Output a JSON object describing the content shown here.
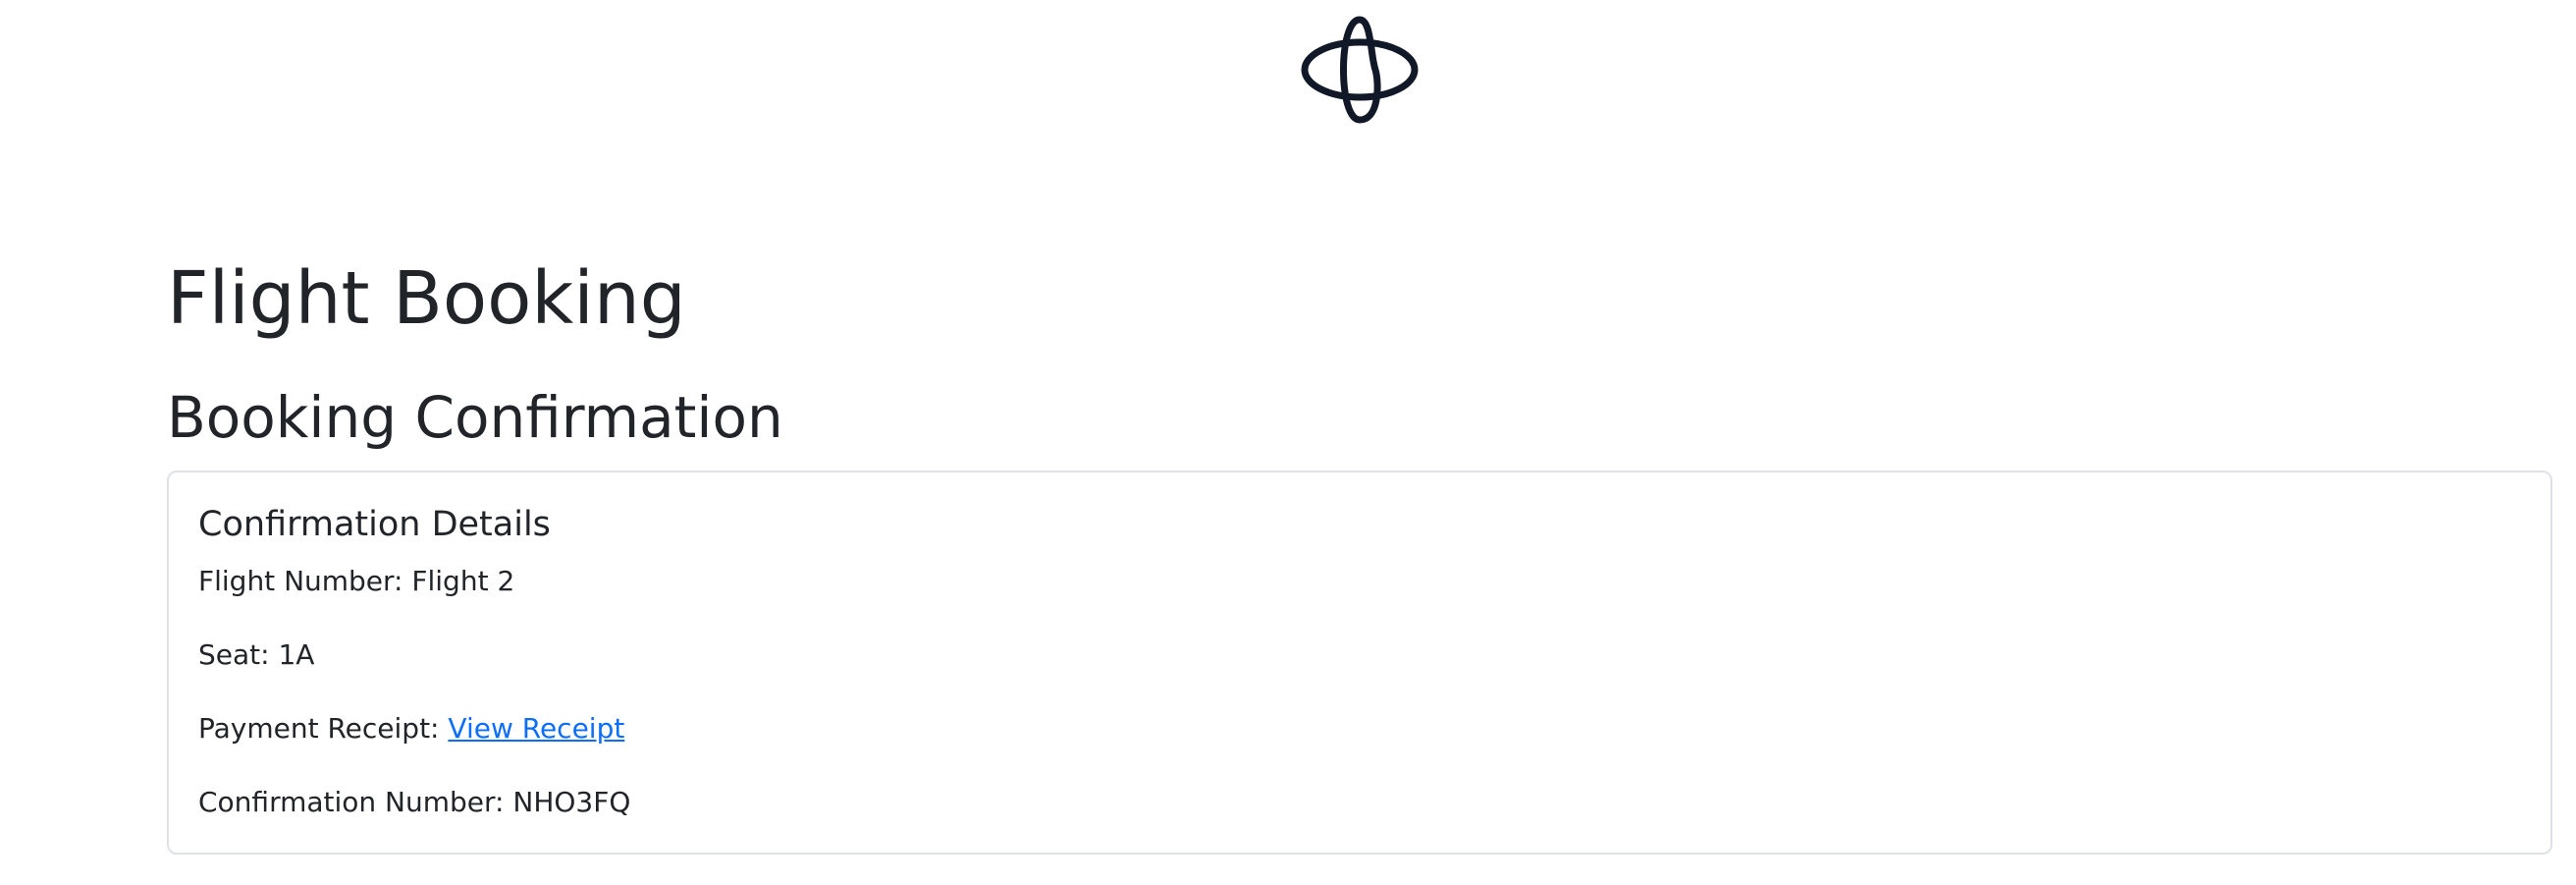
{
  "logo": {
    "icon": "airline-logo-icon"
  },
  "page": {
    "title": "Flight Booking",
    "section_title": "Booking Confirmation"
  },
  "card": {
    "title": "Confirmation Details",
    "flight_label": "Flight Number:",
    "flight_value": "Flight 2",
    "seat_label": "Seat:",
    "seat_value": "1A",
    "receipt_label": "Payment Receipt:",
    "receipt_link": "View Receipt",
    "confirmation_label": "Confirmation Number:",
    "confirmation_value": "NHO3FQ"
  },
  "colors": {
    "text": "#212529",
    "link": "#0d6efd",
    "border": "#dee2e6",
    "logo_stroke": "#111827"
  }
}
